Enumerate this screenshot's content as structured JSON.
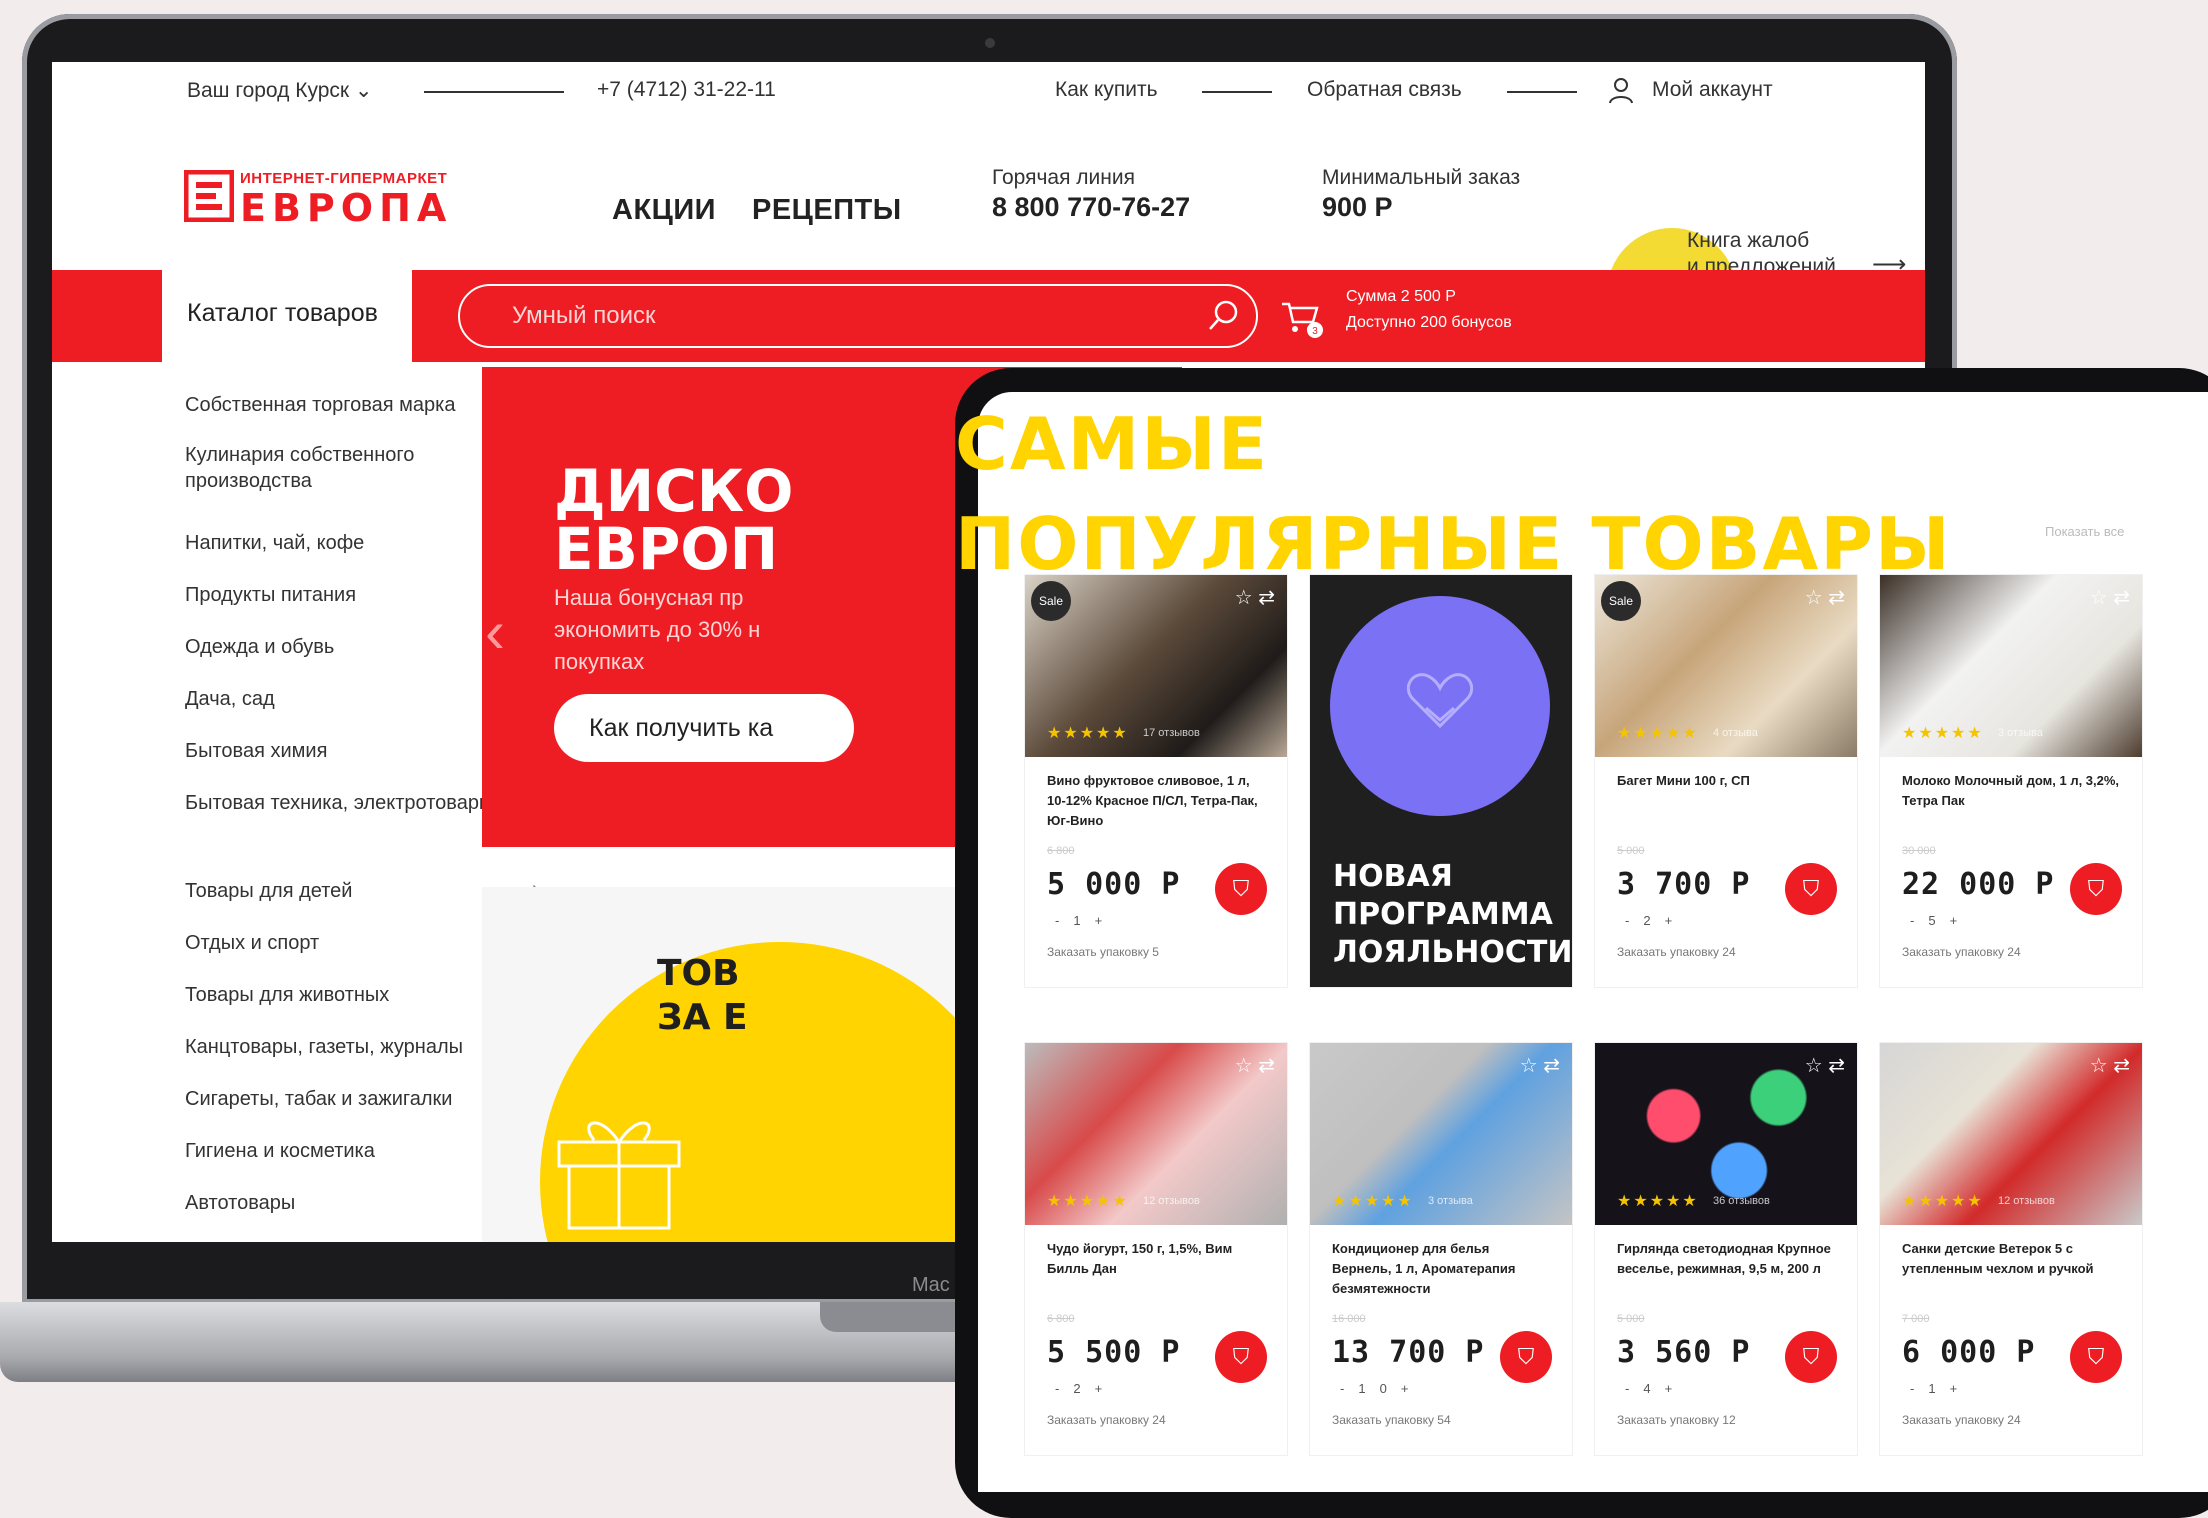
{
  "topbar": {
    "city": "Ваш город Курск ⌄",
    "phone": "+7 (4712) 31-22-11",
    "how_to_buy": "Как купить",
    "feedback": "Обратная связь",
    "account": "Мой аккаунт"
  },
  "logo": {
    "tagline": "ИНТЕРНЕТ-ГИПЕРМАРКЕТ",
    "name": "ЕВРОПА"
  },
  "nav": {
    "promotions": "АКЦИИ",
    "recipes": "РЕЦЕПТЫ"
  },
  "info": {
    "hotline_label": "Горячая линия",
    "hotline_value": "8 800 770-76-27",
    "min_order_label": "Минимальный заказ",
    "min_order_value": "900 Р",
    "complaints": "Книга жалоб\nи предложений"
  },
  "catalog": {
    "title": "Каталог товаров",
    "items": [
      "Собственная торговая марка",
      "Кулинария собственного производства",
      "Напитки, чай, кофе",
      "Продукты питания",
      "Одежда и обувь",
      "Дача, сад",
      "Бытовая химия",
      "Бытовая техника, электротовары",
      "Товары для детей",
      "Отдых и спорт",
      "Товары для животных",
      "Канцтовары, газеты, журналы",
      "Сигареты, табак и зажигалки",
      "Гигиена и косметика",
      "Автотовары"
    ]
  },
  "search": {
    "placeholder": "Умный поиск"
  },
  "cart": {
    "sum": "Сумма 2 500 Р",
    "bonus": "Доступно 200 бонусов"
  },
  "banner": {
    "title_line1": "ДИСКО",
    "title_line2": "ЕВРОП",
    "text": "Наша бонусная пр\nэкономить до 30% н\nпокупках",
    "button": "Как получить ка"
  },
  "banner2": {
    "title_line1": "ТОВ",
    "title_line2": "ЗА Е"
  },
  "laptop_brand": "Mac",
  "popular": {
    "title_line1": "САМЫЕ",
    "title_line2": "ПОПУЛЯРНЫЕ ТОВАРЫ",
    "show_all": "Показать все"
  },
  "loyalty": {
    "title": "НОВАЯ\nПРОГРАММА\nЛОЯЛЬНОСТИ"
  },
  "products": [
    {
      "name": "Вино фруктовое сливовое, 1 л, 10-12% Красное П/СЛ, Тетра-Пак, Юг-Вино",
      "old_price": "6 800",
      "price": "5 000 Р",
      "qty": "1",
      "pack": "Заказать упаковку 5",
      "badge": "Sale",
      "reviews": "17 отзывов"
    },
    {
      "name": "Багет Мини 100 г, СП",
      "old_price": "5 000",
      "price": "3 700 Р",
      "qty": "2",
      "pack": "Заказать упаковку 24",
      "badge": "Sale",
      "reviews": "4 отзыва"
    },
    {
      "name": "Молоко Молочный дом, 1 л, 3,2%, Тетра Пак",
      "old_price": "30 000",
      "price": "22 000 Р",
      "qty": "5",
      "pack": "Заказать упаковку 24",
      "badge": "",
      "reviews": "3 отзыва"
    },
    {
      "name": "Чудо йогурт, 150 г, 1,5%, Вим Билль Дан",
      "old_price": "6 800",
      "price": "5 500 Р",
      "qty": "2",
      "pack": "Заказать упаковку 24",
      "badge": "",
      "reviews": "12 отзывов"
    },
    {
      "name": "Кондиционер для белья Вернель, 1 л, Ароматерапия безмятежности",
      "old_price": "16 000",
      "price": "13 700 Р",
      "qty": "10",
      "pack": "Заказать упаковку 54",
      "badge": "",
      "reviews": "3 отзыва"
    },
    {
      "name": "Гирлянда светодиодная Крупное веселье, режимная, 9,5 м, 200 л",
      "old_price": "5 000",
      "price": "3 560 Р",
      "qty": "4",
      "pack": "Заказать упаковку 12",
      "badge": "",
      "reviews": "36 отзывов"
    },
    {
      "name": "Санки детские Ветерок 5 с утепленным чехлом и ручкой",
      "old_price": "7 000",
      "price": "6 000 Р",
      "qty": "1",
      "pack": "Заказать упаковку 24",
      "badge": "",
      "reviews": "12 отзывов"
    }
  ]
}
